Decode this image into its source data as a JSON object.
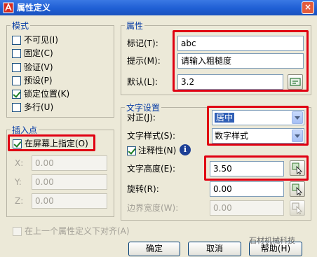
{
  "window": {
    "title": "属性定义",
    "close_glyph": "×"
  },
  "mode": {
    "title": "模式",
    "items": [
      {
        "label": "不可见(I)",
        "checked": false
      },
      {
        "label": "固定(C)",
        "checked": false
      },
      {
        "label": "验证(V)",
        "checked": false
      },
      {
        "label": "预设(P)",
        "checked": false
      },
      {
        "label": "锁定位置(K)",
        "checked": true
      },
      {
        "label": "多行(U)",
        "checked": false
      }
    ]
  },
  "insertion": {
    "title": "插入点",
    "on_screen_label": "在屏幕上指定(O)",
    "on_screen_checked": true,
    "x_label": "X:",
    "x_value": "0.00",
    "y_label": "Y:",
    "y_value": "0.00",
    "z_label": "Z:",
    "z_value": "0.00"
  },
  "attribute": {
    "title": "属性",
    "tag_label": "标记(T):",
    "tag_value": "abc",
    "prompt_label": "提示(M):",
    "prompt_value": "请输入粗糙度",
    "default_label": "默认(L):",
    "default_value": "3.2"
  },
  "text_settings": {
    "title": "文字设置",
    "justify_label": "对正(J):",
    "justify_value": "居中",
    "style_label": "文字样式(S):",
    "style_value": "数字样式",
    "annotative_label": "注释性(N)",
    "annotative_checked": true,
    "info_icon_glyph": "i",
    "height_label": "文字高度(E):",
    "height_value": "3.50",
    "rotation_label": "旋转(R):",
    "rotation_value": "0.00",
    "boundary_label": "边界宽度(W):",
    "boundary_value": "0.00"
  },
  "align_below_label": "在上一个属性定义下对齐(A)",
  "align_below_checked": false,
  "buttons": {
    "ok": "确定",
    "cancel": "取消",
    "help": "帮助(H)"
  },
  "watermark": "石材机械科技"
}
